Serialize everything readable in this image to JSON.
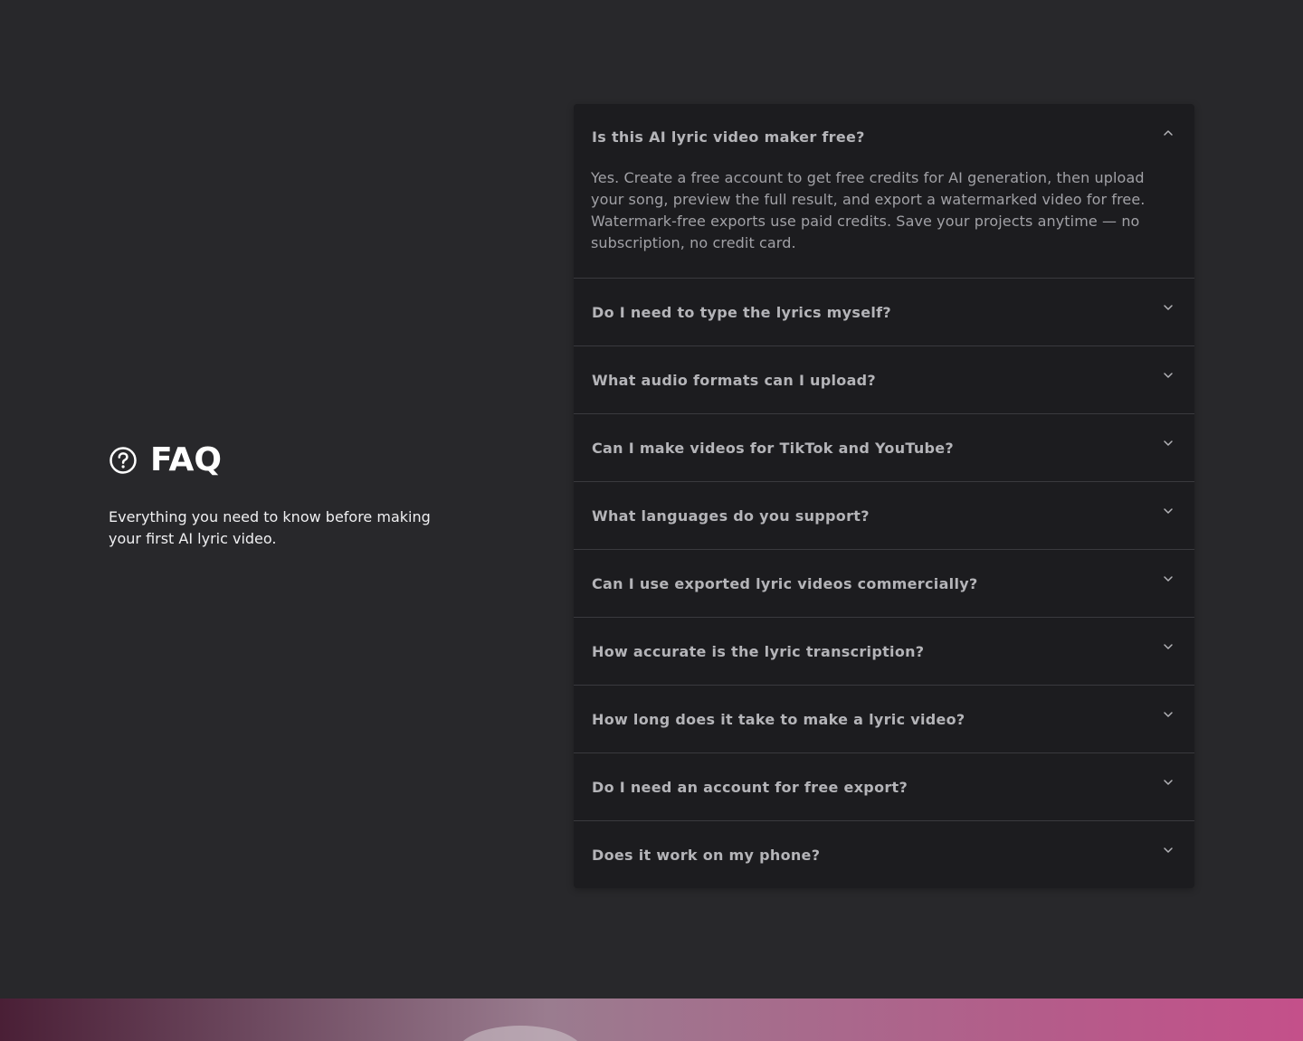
{
  "faq": {
    "title": "FAQ",
    "subtitle": "Everything you need to know before making your first AI lyric video.",
    "icon": "question-circle-icon",
    "items": [
      {
        "question": "Is this AI lyric video maker free?",
        "answer": "Yes. Create a free account to get free credits for AI generation, then upload your song, preview the full result, and export a watermarked video for free. Watermark-free exports use paid credits. Save your projects anytime — no subscription, no credit card.",
        "expanded": true
      },
      {
        "question": "Do I need to type the lyrics myself?",
        "expanded": false
      },
      {
        "question": "What audio formats can I upload?",
        "expanded": false
      },
      {
        "question": "Can I make videos for TikTok and YouTube?",
        "expanded": false
      },
      {
        "question": "What languages do you support?",
        "expanded": false
      },
      {
        "question": "Can I use exported lyric videos commercially?",
        "expanded": false
      },
      {
        "question": "How accurate is the lyric transcription?",
        "expanded": false
      },
      {
        "question": "How long does it take to make a lyric video?",
        "expanded": false
      },
      {
        "question": "Do I need an account for free export?",
        "expanded": false
      },
      {
        "question": "Does it work on my phone?",
        "expanded": false
      }
    ]
  },
  "colors": {
    "background": "#28282b",
    "panel": "#1c1c1f",
    "question_text": "#b4b4b8",
    "answer_text": "#a1a1a6",
    "heading_text": "#ffffff"
  }
}
